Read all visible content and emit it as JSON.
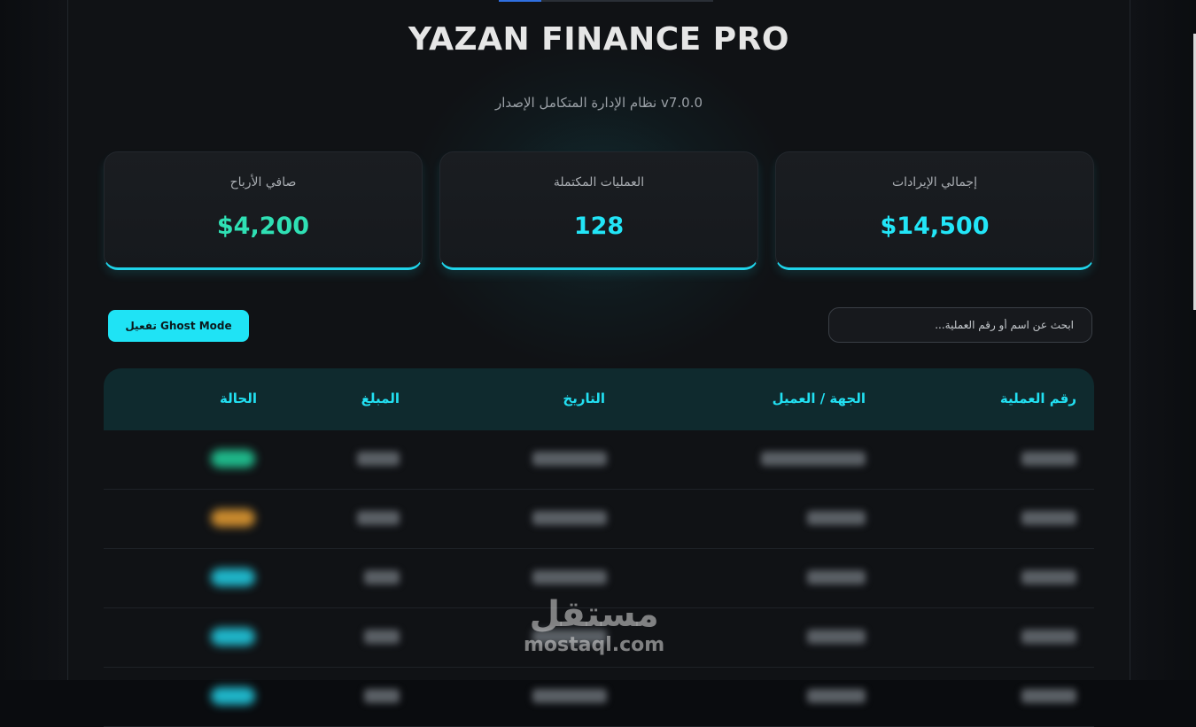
{
  "header": {
    "title": "YAZAN FINANCE PRO",
    "subtitle": "نظام الإدارة المتكامل الإصدار v7.0.0"
  },
  "stats": [
    {
      "label": "إجمالي الإيرادات",
      "value": "$14,500"
    },
    {
      "label": "العمليات المكتملة",
      "value": "128"
    },
    {
      "label": "صافي الأرباح",
      "value": "$4,200"
    }
  ],
  "toolbar": {
    "search_placeholder": "ابحث عن اسم أو رقم العملية...",
    "search_value": "",
    "ghost_button": "تفعيل Ghost Mode"
  },
  "table": {
    "columns": [
      "رقم العملية",
      "الجهة / العميل",
      "التاريخ",
      "المبلغ",
      "الحالة"
    ],
    "status_colors": [
      "#1fb88a",
      "#c98a2e",
      "#1fb5c9",
      "#1fb5c9",
      "#1fb5c9"
    ]
  },
  "watermark": {
    "arabic": "مستقل",
    "latin": "mostaql.com"
  },
  "colors": {
    "accent": "#1fe3f5",
    "profit": "#2fe0b4",
    "background": "#101215"
  }
}
